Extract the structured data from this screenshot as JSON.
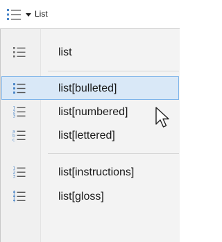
{
  "toolbar": {
    "button_label": "List",
    "icon": "list-bulleted-icon",
    "dropdown_icon": "chevron-down-icon"
  },
  "menu": {
    "items": [
      {
        "label": "list",
        "icon": "list-icon"
      },
      {
        "label": "list[bulleted]",
        "icon": "list-bulleted-icon",
        "highlighted": true
      },
      {
        "label": "list[numbered]",
        "icon": "list-numbered-icon"
      },
      {
        "label": "list[lettered]",
        "icon": "list-lettered-icon"
      },
      {
        "label": "list[instructions]",
        "icon": "list-instructions-icon"
      },
      {
        "label": "list[gloss]",
        "icon": "list-gloss-icon"
      }
    ]
  },
  "colors": {
    "accent": "#4a86c8",
    "highlight_fill": "#d9e8f7",
    "highlight_border": "#7eb4ea",
    "menu_background": "#f3f3f3"
  }
}
